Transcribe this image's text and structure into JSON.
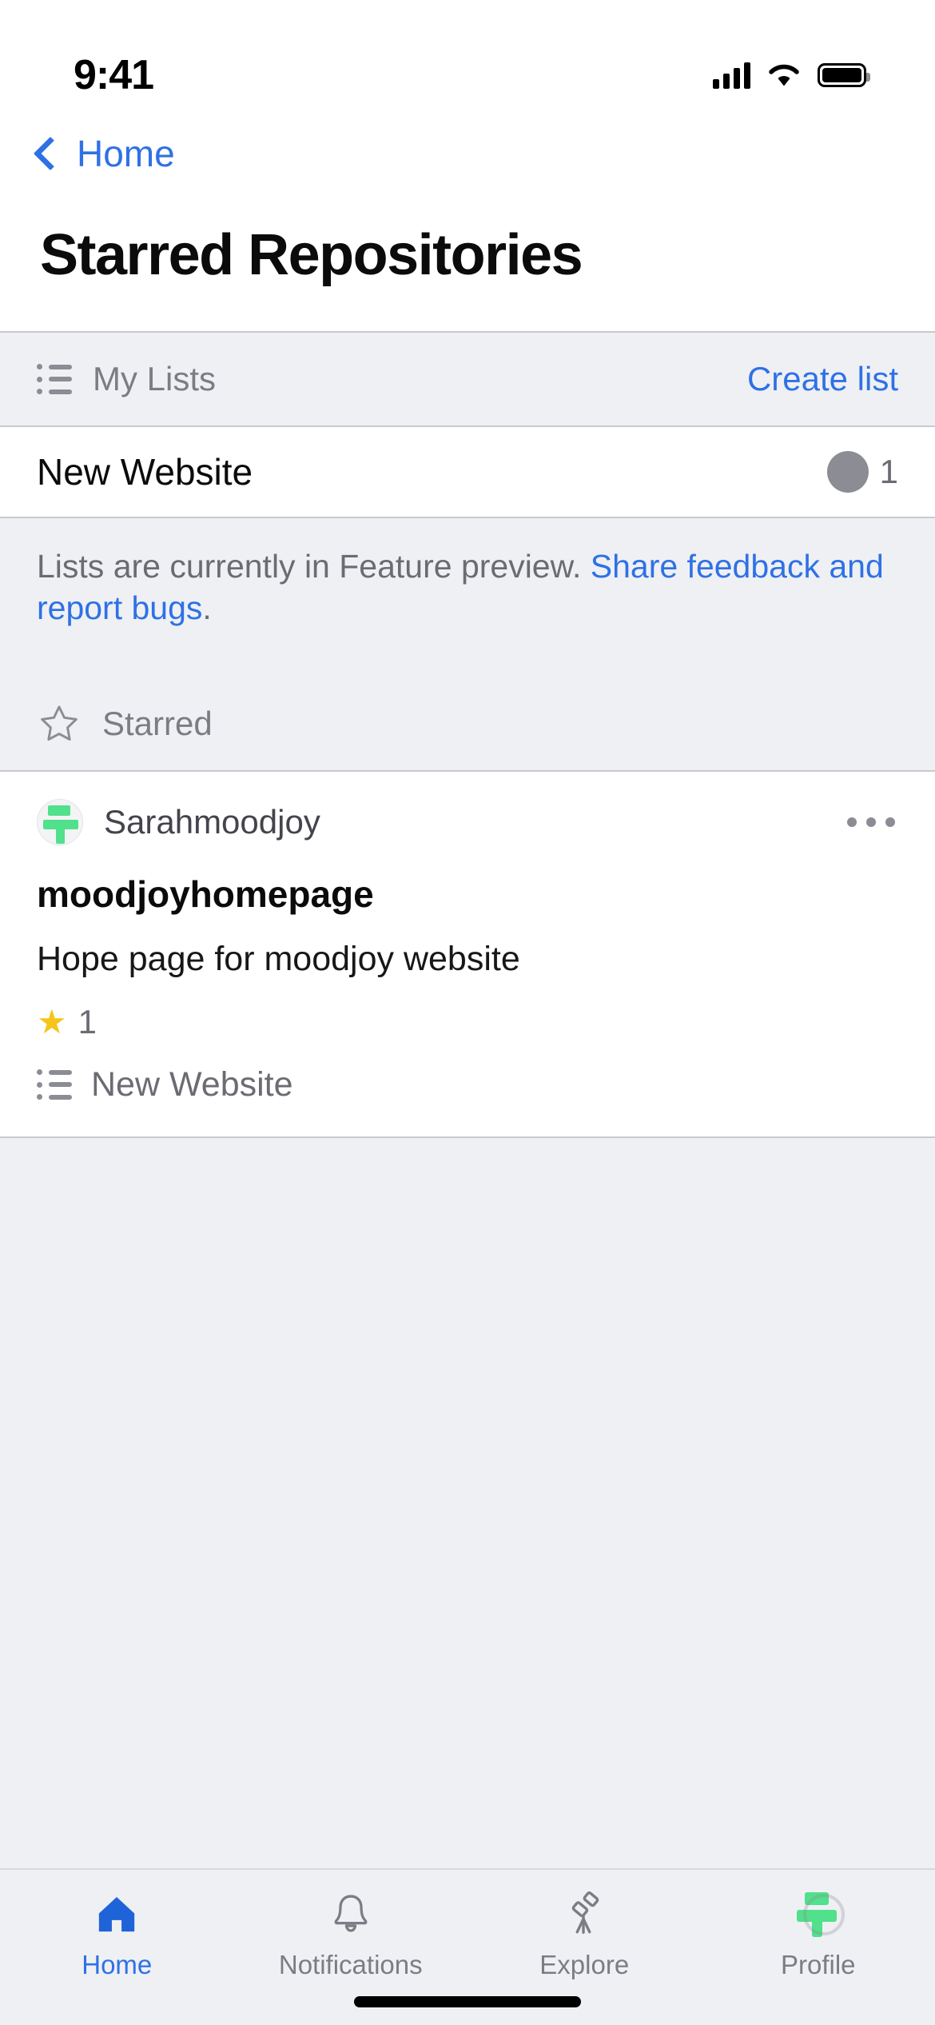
{
  "status_bar": {
    "time": "9:41",
    "signal_icon": "cellular-signal-icon",
    "wifi_icon": "wifi-icon",
    "battery_icon": "battery-icon"
  },
  "nav": {
    "back_label": "Home",
    "back_icon": "chevron-left-icon"
  },
  "header": {
    "title": "Starred Repositories"
  },
  "my_lists": {
    "icon": "list-unordered-icon",
    "label": "My Lists",
    "action_label": "Create list",
    "items": [
      {
        "name": "New Website",
        "avatar_icon": "owner-avatar-icon",
        "count": "1"
      }
    ]
  },
  "notice": {
    "text_before": "Lists are currently in Feature preview. ",
    "link_text": "Share feedback and report bugs",
    "text_after": "."
  },
  "starred_section": {
    "icon": "star-outline-icon",
    "label": "Starred"
  },
  "repositories": [
    {
      "owner": "Sarahmoodjoy",
      "owner_avatar_icon": "moodjoy-avatar-icon",
      "menu_icon": "kebab-menu-icon",
      "name": "moodjoyhomepage",
      "description": "Hope page for moodjoy website",
      "star_icon": "star-filled-icon",
      "star_count": "1",
      "list_icon": "list-unordered-icon",
      "list_name": "New Website"
    }
  ],
  "tabbar": {
    "tabs": [
      {
        "label": "Home",
        "icon": "home-icon",
        "active": true
      },
      {
        "label": "Notifications",
        "icon": "bell-icon",
        "active": false
      },
      {
        "label": "Explore",
        "icon": "telescope-icon",
        "active": false
      },
      {
        "label": "Profile",
        "icon": "profile-avatar-icon",
        "active": false
      }
    ]
  },
  "colors": {
    "accent_blue": "#2f71e5",
    "group_background": "#eff0f4",
    "card_background": "#ffffff",
    "star_yellow": "#f5c518",
    "muted_text": "#6b6b73",
    "avatar_green": "#51e08b"
  }
}
